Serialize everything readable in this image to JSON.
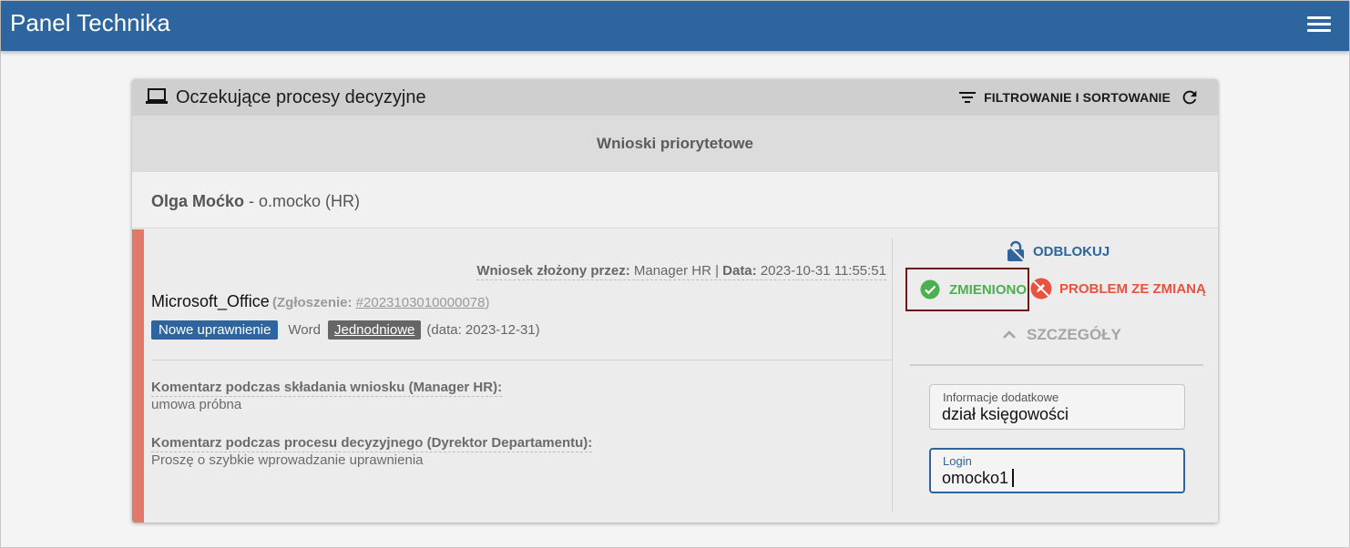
{
  "app": {
    "title": "Panel Technika"
  },
  "card": {
    "title": "Oczekujące procesy decyzyjne",
    "filter_label": "FILTROWANIE I SORTOWANIE"
  },
  "priority": {
    "label": "Wnioski priorytetowe"
  },
  "user": {
    "name": "Olga Moćko",
    "login_info": " - o.mocko (HR)"
  },
  "request": {
    "meta": {
      "submitted_by_label": "Wniosek złożony przez:",
      "submitted_by": " Manager HR | ",
      "date_label": "Data:",
      "date": " 2023-10-31 11:55:51"
    },
    "application": "Microsoft_Office",
    "ticket_label": "(Zgłoszenie: ",
    "ticket_id": "#2023103010000078",
    "ticket_close": ")",
    "tags": {
      "type_badge": "Nowe uprawnienie",
      "product": "Word",
      "duration_badge": "Jednodniowe",
      "until": "(data: 2023-12-31)"
    },
    "comments": [
      {
        "label": "Komentarz podczas składania wniosku (Manager HR):",
        "text": "umowa próbna"
      },
      {
        "label": "Komentarz podczas procesu decyzyjnego (Dyrektor Departamentu):",
        "text": "Proszę o szybkie wprowadzanie uprawnienia"
      }
    ]
  },
  "actions": {
    "unlock": "ODBLOKUJ",
    "changed": "ZMIENIONO",
    "problem": "PROBLEM ZE ZMIANĄ",
    "details": "SZCZEGÓŁY"
  },
  "fields": {
    "additional_info": {
      "label": "Informacje dodatkowe",
      "value": "dział księgowości"
    },
    "login": {
      "label": "Login",
      "value": "omocko1"
    }
  },
  "colors": {
    "primary": "#2f659f",
    "accent_bar": "#e0796a",
    "success": "#4caf50",
    "danger": "#e8523f",
    "highlight_border": "#6b1a1a"
  },
  "icons": [
    "menu-icon",
    "laptop-icon",
    "filter-icon",
    "refresh-icon",
    "unlock-icon",
    "check-circle-icon",
    "no-edit-icon",
    "chevron-up-icon"
  ]
}
